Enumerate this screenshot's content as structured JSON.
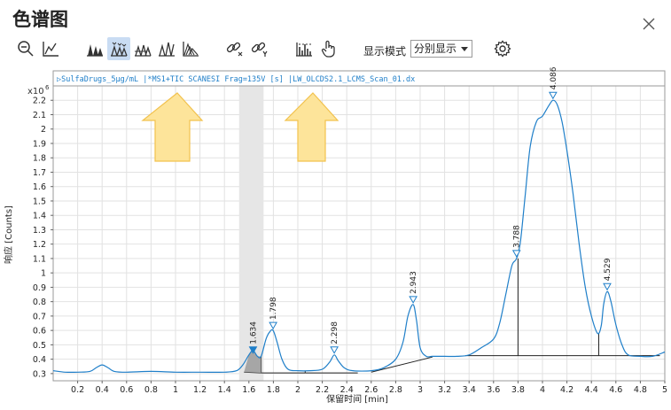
{
  "window": {
    "title": "色谱图",
    "close_icon": "close-icon"
  },
  "toolbar": {
    "buttons": [
      {
        "name": "zoom-out-button",
        "icon": "zoom-out-icon",
        "active": false
      },
      {
        "name": "auto-scale-button",
        "icon": "auto-scale-axes-icon",
        "active": false
      },
      {
        "name": "integrate-peaks-button",
        "icon": "integrate-peaks-icon",
        "active": false
      },
      {
        "name": "peak-labels-button",
        "icon": "peak-labels-icon",
        "active": true
      },
      {
        "name": "peak-baseline-button",
        "icon": "peak-baseline-icon",
        "active": false
      },
      {
        "name": "manual-integration-button",
        "icon": "manual-integration-icon",
        "active": false
      },
      {
        "name": "overlay-button",
        "icon": "overlay-traces-icon",
        "active": false
      },
      {
        "name": "unlink-x-button",
        "icon": "unlink-x-icon",
        "active": false
      },
      {
        "name": "unlink-y-button",
        "icon": "unlink-y-icon",
        "active": false
      },
      {
        "name": "spectrum-button",
        "icon": "spectrum-icon",
        "active": false
      },
      {
        "name": "pointer-mode-button",
        "icon": "hand-pointer-icon",
        "active": false
      },
      {
        "name": "settings-button",
        "icon": "gear-icon",
        "active": false
      }
    ],
    "display_mode_label": "显示模式",
    "display_mode_value": "分别显示"
  },
  "colors": {
    "trace": "#1f7fc9",
    "header_text": "#1f7fc9",
    "grid": "#e2e2e2",
    "highlight_band": "#e6e6e6",
    "arrow_fill": "#fde49a",
    "arrow_stroke": "#f2c24e",
    "baseline": "#222222",
    "selected_peak_fill": "#9a9a9a"
  },
  "chart_data": {
    "type": "line",
    "header": "▷SulfaDrugs_5μg/mL |*MS1+TIC SCANESI Frag=135V [s] |LW_OLCDS2.1_LCMS_Scan_01.dx",
    "y_multiplier": "x10",
    "y_exponent": "6",
    "xlabel": "保留时间 [min]",
    "ylabel": "响应 [Counts]",
    "xlim": [
      0,
      5
    ],
    "ylim": [
      0.25,
      2.3
    ],
    "x_ticks": [
      0.2,
      0.4,
      0.6,
      0.8,
      1,
      1.2,
      1.4,
      1.6,
      1.8,
      2,
      2.2,
      2.4,
      2.6,
      2.8,
      3,
      3.2,
      3.4,
      3.6,
      3.8,
      4,
      4.2,
      4.4,
      4.6,
      4.8,
      5
    ],
    "x_tick_labels": [
      "0.2",
      "0.4",
      "0.6",
      "0.8",
      "1",
      "1.2",
      "1.4",
      "1.6",
      "1.8",
      "2",
      "2.2",
      "2.4",
      "2.6",
      "2.8",
      "3",
      "3.2",
      "3.4",
      "3.6",
      "3.8",
      "4",
      "4.2",
      "4.4",
      "4.6",
      "4.8",
      "5"
    ],
    "y_ticks": [
      0.3,
      0.4,
      0.5,
      0.6,
      0.7,
      0.8,
      0.9,
      1,
      1.1,
      1.2,
      1.3,
      1.4,
      1.5,
      1.6,
      1.7,
      1.8,
      1.9,
      2,
      2.1,
      2.2
    ],
    "y_tick_labels": [
      "0.3",
      "0.4",
      "0.5",
      "0.6",
      "0.7",
      "0.8",
      "0.9",
      "1",
      "1.1",
      "1.2",
      "1.3",
      "1.4",
      "1.5",
      "1.6",
      "1.7",
      "1.8",
      "1.9",
      "2",
      "2.1",
      "2.2"
    ],
    "highlight_range": [
      1.52,
      1.72
    ],
    "series": [
      {
        "x": [
          0.0,
          0.1,
          0.2,
          0.3,
          0.35,
          0.4,
          0.45,
          0.5,
          0.6,
          0.8,
          1.0,
          1.2,
          1.4,
          1.5,
          1.55,
          1.6,
          1.634,
          1.67,
          1.7,
          1.74,
          1.77,
          1.798,
          1.83,
          1.87,
          1.92,
          2.0,
          2.1,
          2.2,
          2.26,
          2.298,
          2.33,
          2.38,
          2.45,
          2.6,
          2.7,
          2.8,
          2.86,
          2.9,
          2.943,
          2.97,
          3.0,
          3.05,
          3.1,
          3.2,
          3.3,
          3.4,
          3.5,
          3.6,
          3.65,
          3.7,
          3.75,
          3.788,
          3.82,
          3.86,
          3.9,
          3.95,
          4.0,
          4.05,
          4.086,
          4.12,
          4.16,
          4.2,
          4.25,
          4.3,
          4.35,
          4.4,
          4.45,
          4.48,
          4.5,
          4.529,
          4.56,
          4.6,
          4.65,
          4.7,
          4.8,
          4.9,
          5.0
        ],
        "y": [
          0.32,
          0.31,
          0.31,
          0.315,
          0.34,
          0.36,
          0.34,
          0.315,
          0.31,
          0.315,
          0.31,
          0.31,
          0.31,
          0.32,
          0.36,
          0.43,
          0.46,
          0.42,
          0.42,
          0.54,
          0.59,
          0.6,
          0.52,
          0.4,
          0.33,
          0.32,
          0.32,
          0.33,
          0.38,
          0.43,
          0.39,
          0.34,
          0.32,
          0.32,
          0.34,
          0.4,
          0.52,
          0.7,
          0.78,
          0.67,
          0.48,
          0.42,
          0.42,
          0.42,
          0.42,
          0.43,
          0.48,
          0.54,
          0.65,
          0.85,
          1.05,
          1.1,
          1.22,
          1.55,
          1.88,
          2.05,
          2.09,
          2.16,
          2.2,
          2.17,
          2.05,
          1.85,
          1.55,
          1.2,
          0.9,
          0.7,
          0.58,
          0.63,
          0.78,
          0.87,
          0.8,
          0.64,
          0.5,
          0.43,
          0.42,
          0.42,
          0.45
        ]
      }
    ],
    "peaks": [
      {
        "rt": 1.634,
        "label": "1.634",
        "marker_y": 0.43,
        "selected": true
      },
      {
        "rt": 1.798,
        "label": "1.798",
        "marker_y": 0.6,
        "selected": false
      },
      {
        "rt": 2.298,
        "label": "2.298",
        "marker_y": 0.43,
        "selected": false
      },
      {
        "rt": 2.943,
        "label": "2.943",
        "marker_y": 0.78,
        "selected": false
      },
      {
        "rt": 3.788,
        "label": "3.788",
        "marker_y": 1.1,
        "selected": false
      },
      {
        "rt": 4.086,
        "label": "4.086",
        "marker_y": 2.2,
        "selected": false
      },
      {
        "rt": 4.529,
        "label": "4.529",
        "marker_y": 0.87,
        "selected": false
      }
    ],
    "baselines": [
      {
        "x": [
          1.56,
          1.7
        ],
        "y": [
          0.31,
          0.305
        ]
      },
      {
        "x": [
          1.7,
          2.06
        ],
        "y": [
          0.305,
          0.305
        ]
      },
      {
        "x": [
          2.06,
          2.49
        ],
        "y": [
          0.305,
          0.305
        ]
      },
      {
        "x": [
          2.6,
          3.1
        ],
        "y": [
          0.31,
          0.415
        ]
      },
      {
        "x": [
          3.37,
          4.46
        ],
        "y": [
          0.425,
          0.425
        ]
      },
      {
        "x": [
          4.46,
          4.96
        ],
        "y": [
          0.425,
          0.425
        ]
      }
    ],
    "drop_lines": [
      {
        "x": 1.7,
        "y_top": 0.42,
        "y_bottom": 0.305
      },
      {
        "x": 2.06,
        "y_top": 0.32,
        "y_bottom": 0.305
      },
      {
        "x": 3.1,
        "y_top": 0.42,
        "y_bottom": 0.415
      },
      {
        "x": 3.8,
        "y_top": 1.1,
        "y_bottom": 0.425
      },
      {
        "x": 4.46,
        "y_top": 0.58,
        "y_bottom": 0.425
      }
    ]
  }
}
